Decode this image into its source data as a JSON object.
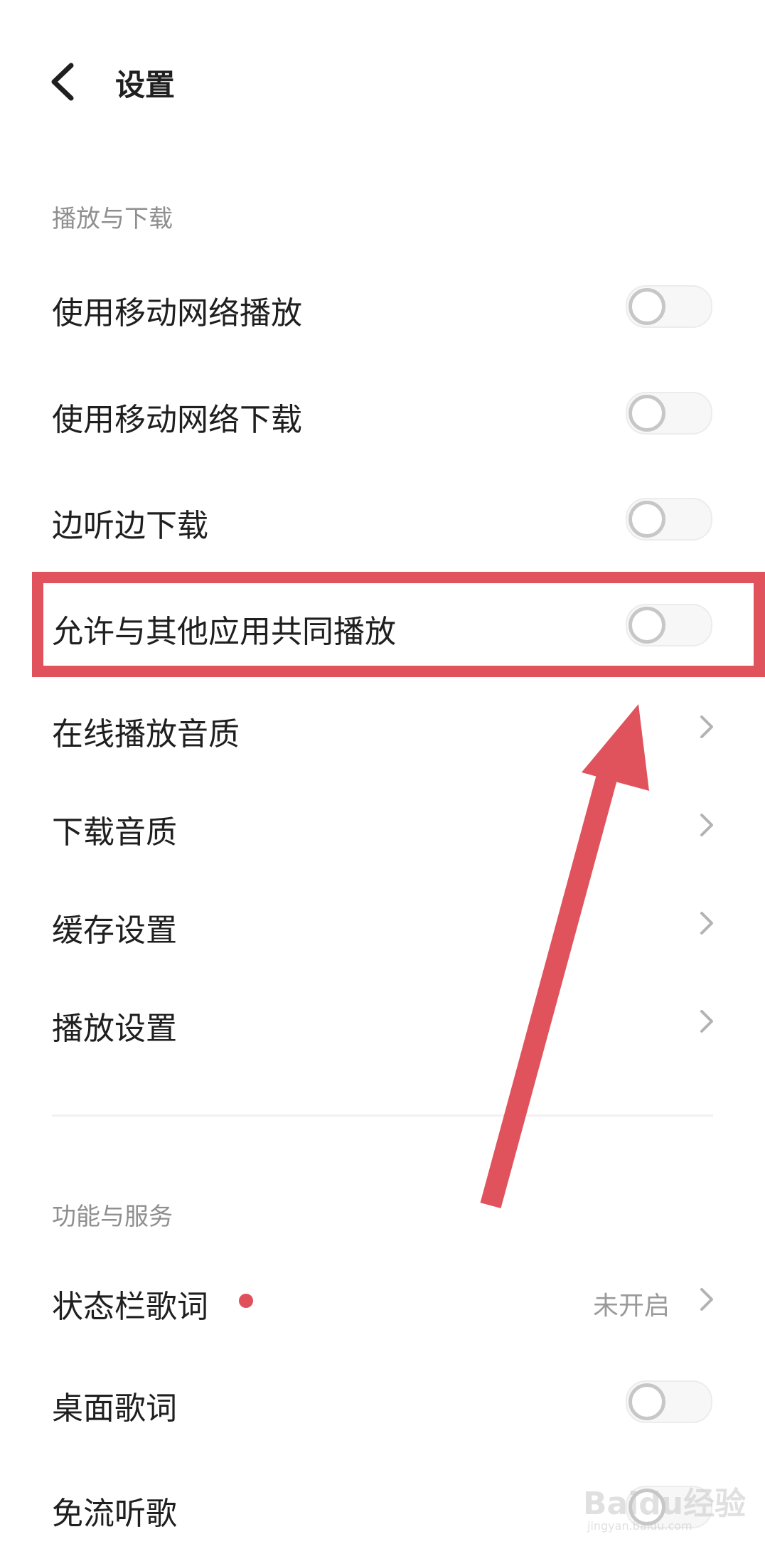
{
  "header": {
    "title": "设置"
  },
  "section_playback": {
    "title": "播放与下载",
    "items": [
      {
        "label": "使用移动网络播放",
        "toggle_on": false
      },
      {
        "label": "使用移动网络下载",
        "toggle_on": false
      },
      {
        "label": "边听边下载",
        "toggle_on": false
      },
      {
        "label": "允许与其他应用共同播放",
        "toggle_on": false
      },
      {
        "label": "在线播放音质"
      },
      {
        "label": "下载音质"
      },
      {
        "label": "缓存设置"
      },
      {
        "label": "播放设置"
      }
    ]
  },
  "section_features": {
    "title": "功能与服务",
    "items": [
      {
        "label": "状态栏歌词",
        "value": "未开启",
        "has_badge": true
      },
      {
        "label": "桌面歌词",
        "toggle_on": false
      },
      {
        "label": "免流听歌",
        "toggle_on": false
      }
    ]
  },
  "watermark": {
    "text": "Baidu经验",
    "sub": "jingyan.baidu.com"
  },
  "colors": {
    "annotation_red": "#e0535d",
    "badge_red": "#e0505a",
    "section_title_gray": "#8f8f8f",
    "toggle_knob_gray": "#c7c7c7"
  }
}
